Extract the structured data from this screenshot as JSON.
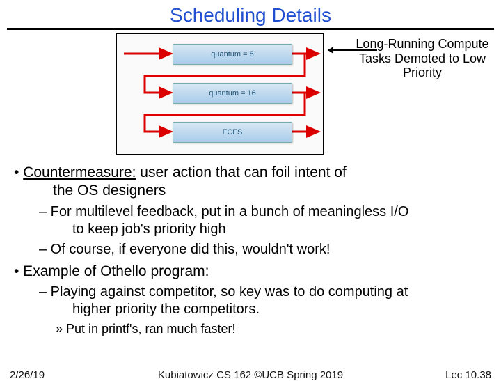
{
  "title": "Scheduling Details",
  "diagram": {
    "q1": "quantum = 8",
    "q2": "quantum = 16",
    "q3": "FCFS",
    "callout": "Long-Running Compute Tasks Demoted to Low Priority"
  },
  "bullets": {
    "cm_lead": "Countermeasure:",
    "cm_rest": " user action that can foil intent of",
    "cm_rest2": "the OS designers",
    "cm_sub1a": "– For multilevel feedback, put in a bunch of meaningless I/O",
    "cm_sub1b": "to keep job's priority high",
    "cm_sub2": "– Of course, if everyone did this, wouldn't work!",
    "ex_lead": "• Example of Othello program:",
    "ex_sub1a": "– Playing against competitor, so key was to do computing at",
    "ex_sub1b": "higher priority the competitors.",
    "ex_sub2": "» Put in printf's, ran much faster!"
  },
  "footer": {
    "left": "2/26/19",
    "mid": "Kubiatowicz CS 162 ©UCB Spring 2019",
    "right": "Lec 10.38"
  }
}
